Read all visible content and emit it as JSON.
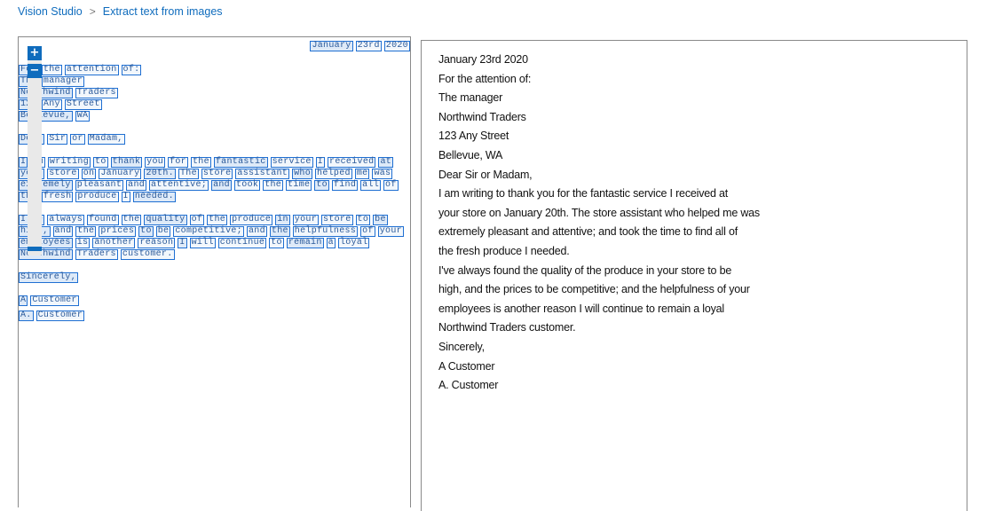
{
  "breadcrumb": {
    "items": [
      "Vision Studio",
      "Extract text from images"
    ],
    "separator": ">"
  },
  "zoom": {
    "in_label": "+",
    "out_label": "−"
  },
  "document_image": {
    "lines": [
      [
        "January",
        "23rd",
        "2020"
      ],
      [
        "For",
        "the",
        "attention",
        "of:"
      ],
      [
        "The",
        "manager"
      ],
      [
        "Northwind",
        "Traders"
      ],
      [
        "123",
        "Any",
        "Street"
      ],
      [
        "Bellevue,",
        "WA"
      ],
      [
        "Dear",
        "Sir",
        "or",
        "Madam,"
      ],
      [
        "I",
        "am",
        "writing",
        "to",
        "thank",
        "you",
        "for",
        "the",
        "fantastic",
        "service",
        "I",
        "received",
        "at"
      ],
      [
        "your",
        "store",
        "on",
        "January",
        "20th.",
        "The",
        "store",
        "assistant",
        "who",
        "helped",
        "me",
        "was"
      ],
      [
        "extremely",
        "pleasant",
        "and",
        "attentive;",
        "and",
        "took",
        "the",
        "time",
        "to",
        "find",
        "all",
        "of"
      ],
      [
        "the",
        "fresh",
        "produce",
        "I",
        "needed."
      ],
      [
        "I've",
        "always",
        "found",
        "the",
        "quality",
        "of",
        "the",
        "produce",
        "in",
        "your",
        "store",
        "to",
        "be"
      ],
      [
        "high,",
        "and",
        "the",
        "prices",
        "to",
        "be",
        "competitive;",
        "and",
        "the",
        "helpfulness",
        "of",
        "your"
      ],
      [
        "employees",
        "is",
        "another",
        "reason",
        "I",
        "will",
        "continue",
        "to",
        "remain",
        "a",
        "loyal"
      ],
      [
        "Northwind",
        "Traders",
        "customer."
      ],
      [
        "Sincerely,"
      ],
      [
        "A",
        "Customer"
      ],
      [
        "A.",
        "Customer"
      ]
    ]
  },
  "extracted_text": {
    "lines": [
      "January 23rd 2020",
      "For the attention of:",
      "The manager",
      "Northwind Traders",
      "123 Any Street",
      "Bellevue, WA",
      "Dear Sir or Madam,",
      "I am writing to thank you for the fantastic service I received at",
      "your store on January 20th. The store assistant who helped me was",
      "extremely pleasant and attentive; and took the time to find all of",
      "the fresh produce I needed.",
      "I've always found the quality of the produce in your store to be",
      "high, and the prices to be competitive; and the helpfulness of your",
      "employees is another reason I will continue to remain a loyal",
      "Northwind Traders customer.",
      "Sincerely,",
      "A Customer",
      "A. Customer"
    ]
  },
  "colors": {
    "accent": "#0f6cbd",
    "box_border": "#1f6fd2",
    "panel_border": "#8a8a8a"
  }
}
